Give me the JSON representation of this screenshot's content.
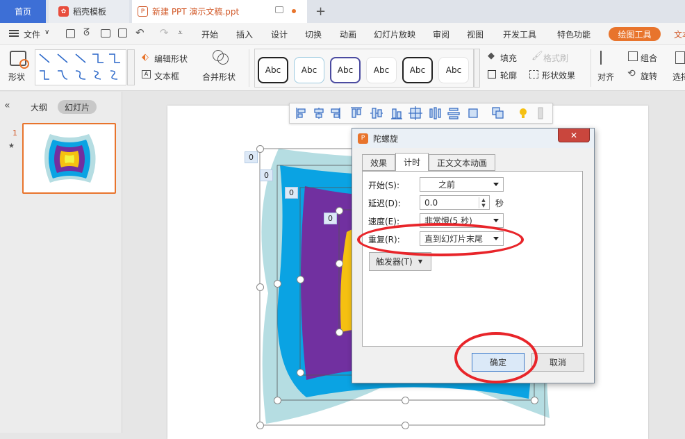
{
  "tabs": {
    "home": "首页",
    "template": "稻壳模板",
    "document": "新建 PPT 演示文稿.ppt",
    "add": "+"
  },
  "menu": {
    "file": "文件",
    "items": [
      "开始",
      "插入",
      "设计",
      "切换",
      "动画",
      "幻灯片放映",
      "审阅",
      "视图",
      "开发工具",
      "特色功能"
    ],
    "drawing_tools": "绘图工具",
    "text_tools": "文本"
  },
  "ribbon": {
    "shape": "形状",
    "edit_shape": "编辑形状",
    "textbox": "文本框",
    "merge_shape": "合并形状",
    "style_samples": [
      "Abc",
      "Abc",
      "Abc",
      "Abc",
      "Abc",
      "Abc"
    ],
    "fill": "填充",
    "format_brush": "格式刷",
    "outline": "轮廓",
    "shape_effect": "形状效果",
    "align": "对齐",
    "group": "组合",
    "rotate": "旋转",
    "select": "选择"
  },
  "left_pane": {
    "outline_tab": "大纲",
    "slides_tab": "幻灯片",
    "slide_number": "1"
  },
  "slide_tags": [
    "0",
    "0",
    "0",
    "0"
  ],
  "dialog": {
    "title": "陀螺旋",
    "close": "✕",
    "tabs": [
      "效果",
      "计时",
      "正文文本动画"
    ],
    "start_label": "开始(S):",
    "start_value": "之前",
    "delay_label": "延迟(D):",
    "delay_value": "0.0",
    "delay_unit": "秒",
    "speed_label": "速度(E):",
    "speed_value": "非常慢(5 秒)",
    "repeat_label": "重复(R):",
    "repeat_value": "直到幻灯片末尾",
    "trigger": "触发器(T)",
    "ok": "确定",
    "cancel": "取消"
  },
  "colors": {
    "accent": "#e8742c",
    "shape_outer": "#b5dde2",
    "shape_blue": "#0aa3e3",
    "shape_purple": "#7130a0",
    "shape_yellow": "#f5c011",
    "annotation": "#e8252a"
  }
}
